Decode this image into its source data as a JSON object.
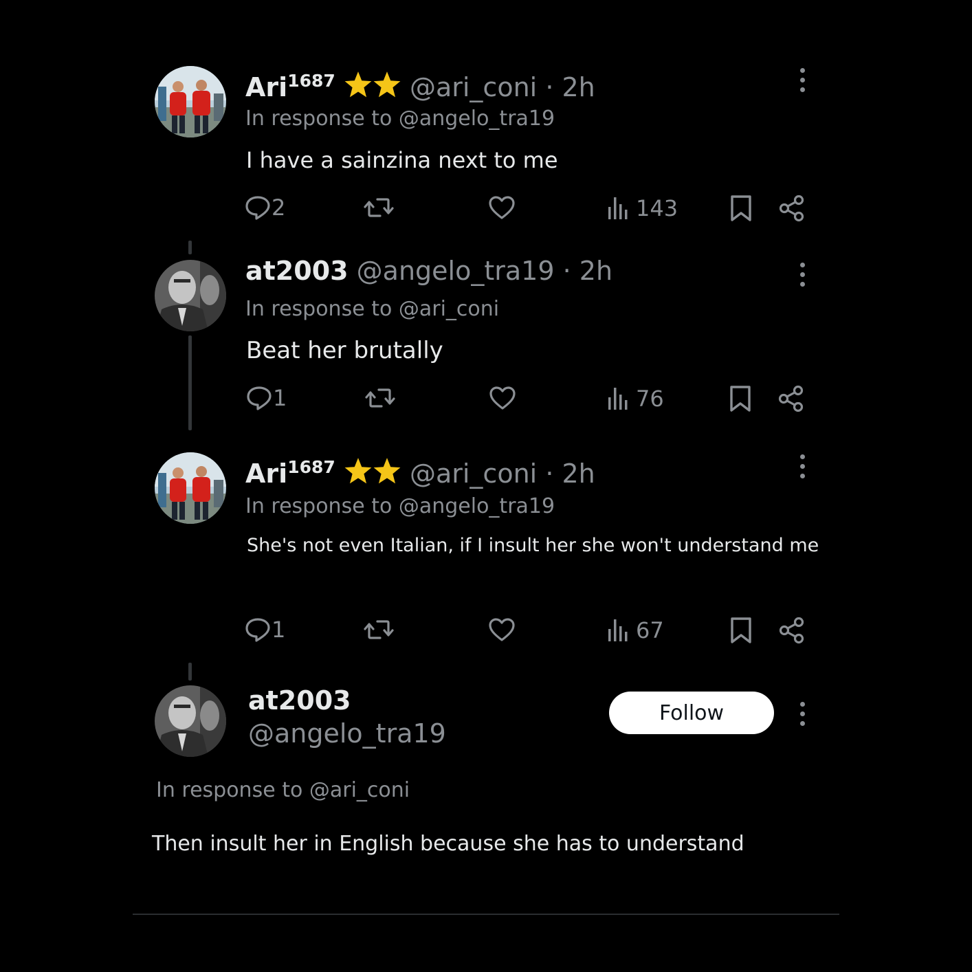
{
  "colors": {
    "background": "#000000",
    "text": "#e7e9ea",
    "muted": "#8b8f94",
    "star": "#f5c518",
    "follow_bg": "#ffffff"
  },
  "tweets": [
    {
      "display_name": "Ari",
      "name_sup": "1687",
      "badges": [
        "star-icon",
        "star-icon"
      ],
      "handle": "@ari_coni",
      "time": "· 2h",
      "reply_to": "In response to @angelo_tra19",
      "text": "I have a sainzina next to me",
      "replies": "2",
      "views": "143"
    },
    {
      "display_name": "at2003",
      "handle": "@angelo_tra19",
      "time": "· 2h",
      "reply_to": "In response to @ari_coni",
      "text": "Beat her brutally",
      "replies": "1",
      "views": "76"
    },
    {
      "display_name": "Ari",
      "name_sup": "1687",
      "badges": [
        "star-icon",
        "star-icon"
      ],
      "handle": "@ari_coni",
      "time": "· 2h",
      "reply_to": "In response to @angelo_tra19",
      "text": "She's not even Italian, if I insult her she won't understand me",
      "replies": "1",
      "views": "67"
    }
  ],
  "focused": {
    "display_name": "at2003",
    "handle": "@angelo_tra19",
    "follow_label": "Follow",
    "reply_to": "In response to @ari_coni",
    "text": "Then insult her in English because she has to understand"
  }
}
